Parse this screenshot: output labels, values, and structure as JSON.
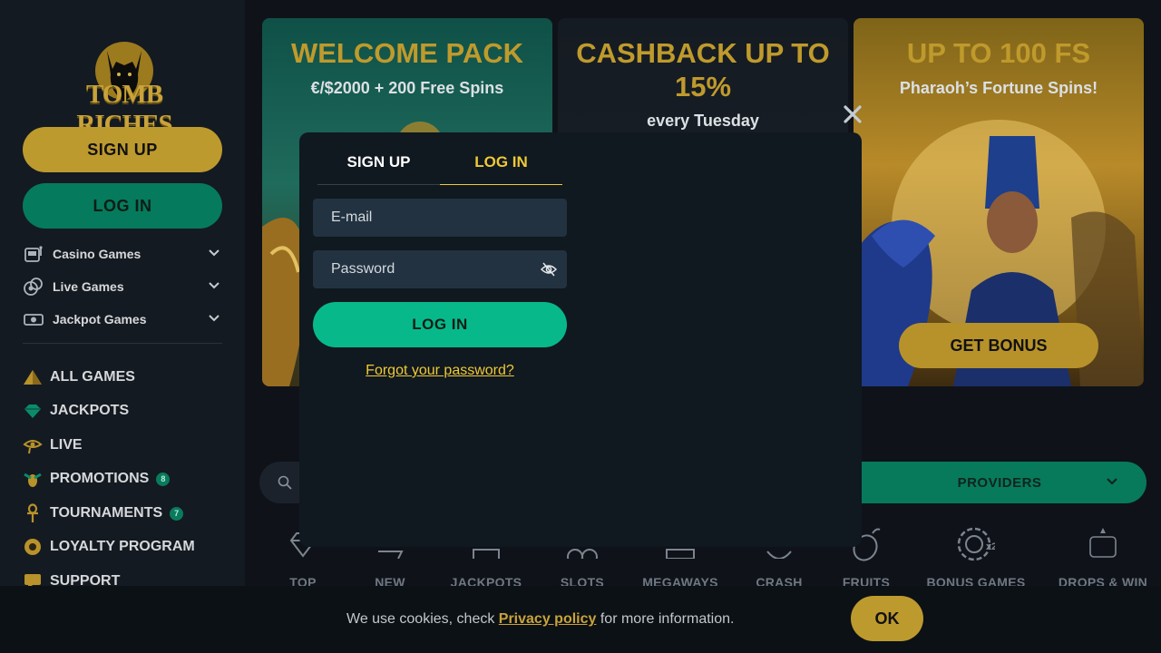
{
  "brand": {
    "logo_text": "TOMB RICHES"
  },
  "sidebar": {
    "signup_label": "SIGN UP",
    "login_label": "LOG IN",
    "categories": [
      {
        "label": "Casino Games",
        "icon": "slot-machine-icon"
      },
      {
        "label": "Live Games",
        "icon": "chips-icon"
      },
      {
        "label": "Jackpot Games",
        "icon": "cash-icon"
      }
    ],
    "nav": [
      {
        "label": "ALL GAMES",
        "icon": "pyramid-icon"
      },
      {
        "label": "JACKPOTS",
        "icon": "gem-icon"
      },
      {
        "label": "LIVE",
        "icon": "eye-of-horus-icon"
      },
      {
        "label": "PROMOTIONS",
        "icon": "scarab-icon",
        "badge": "8"
      },
      {
        "label": "TOURNAMENTS",
        "icon": "ankh-icon",
        "badge": "7"
      },
      {
        "label": "LOYALTY PROGRAM",
        "icon": "medal-icon"
      },
      {
        "label": "SUPPORT",
        "icon": "chat-icon"
      }
    ]
  },
  "banners": [
    {
      "title": "WELCOME PACK",
      "subtitle": "€/$2000 + 200 Free Spins"
    },
    {
      "title": "CASHBACK UP TO 15%",
      "subtitle": "every Tuesday"
    },
    {
      "title": "UP TO 100 FS",
      "subtitle": "Pharaoh’s Fortune Spins!",
      "cta": "GET BONUS"
    }
  ],
  "filters": {
    "providers_label": "PROVIDERS"
  },
  "game_categories": [
    "TOP",
    "NEW",
    "JACKPOTS",
    "SLOTS",
    "MEGAWAYS",
    "CRASH",
    "FRUITS",
    "BONUS GAMES",
    "DROPS & WIN"
  ],
  "modal": {
    "tab_signup": "SIGN UP",
    "tab_login": "LOG IN",
    "email_placeholder": "E-mail",
    "password_placeholder": "Password",
    "login_button": "LOG IN",
    "forgot_link": "Forgot your password?"
  },
  "cookie": {
    "text_before": "We use cookies, check ",
    "link": "Privacy policy",
    "text_after": " for more information.",
    "ok": "OK"
  },
  "colors": {
    "gold": "#bd9a2e",
    "green": "#07b98a",
    "yellow_active": "#f0c936",
    "bg": "#0f1319"
  }
}
